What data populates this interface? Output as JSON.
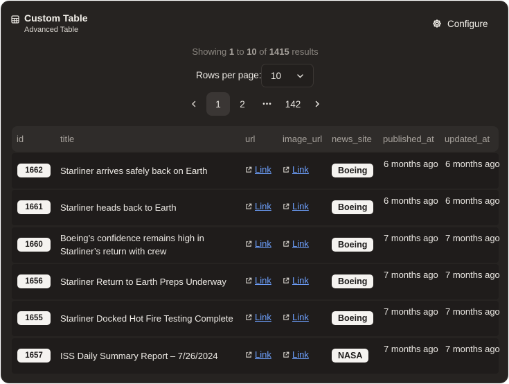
{
  "header": {
    "title": "Custom Table",
    "subtitle": "Advanced Table",
    "configure_label": "Configure",
    "table_icon": "table-icon",
    "gear_icon": "gear-icon"
  },
  "summary": {
    "prefix": "Showing",
    "from": "1",
    "to_word": "to",
    "to": "10",
    "of_word": "of",
    "total": "1415",
    "suffix": "results"
  },
  "rows_per_page": {
    "label": "Rows per page:",
    "value": "10"
  },
  "pagination": {
    "prev_icon": "chevron-left-icon",
    "pages": [
      "1",
      "2",
      "•••",
      "142"
    ],
    "active_page": "1",
    "next_icon": "chevron-right-icon"
  },
  "table": {
    "columns": [
      "id",
      "title",
      "url",
      "image_url",
      "news_site",
      "published_at",
      "updated_at"
    ],
    "link_label": "Link",
    "rows": [
      {
        "id": "1662",
        "title": "Starliner arrives safely back on Earth",
        "news_site": "Boeing",
        "published_at": "6 months ago",
        "updated_at": "6 months ago"
      },
      {
        "id": "1661",
        "title": "Starliner heads back to Earth",
        "news_site": "Boeing",
        "published_at": "6 months ago",
        "updated_at": "6 months ago"
      },
      {
        "id": "1660",
        "title": "Boeing’s confidence remains high in Starliner’s return with crew",
        "news_site": "Boeing",
        "published_at": "7 months ago",
        "updated_at": "7 months ago"
      },
      {
        "id": "1656",
        "title": "Starliner Return to Earth Preps Underway",
        "news_site": "Boeing",
        "published_at": "7 months ago",
        "updated_at": "7 months ago"
      },
      {
        "id": "1655",
        "title": "Starliner Docked Hot Fire Testing Complete",
        "news_site": "Boeing",
        "published_at": "7 months ago",
        "updated_at": "7 months ago"
      },
      {
        "id": "1657",
        "title": "ISS Daily Summary Report – 7/26/2024",
        "news_site": "NASA",
        "published_at": "7 months ago",
        "updated_at": "7 months ago"
      }
    ]
  }
}
